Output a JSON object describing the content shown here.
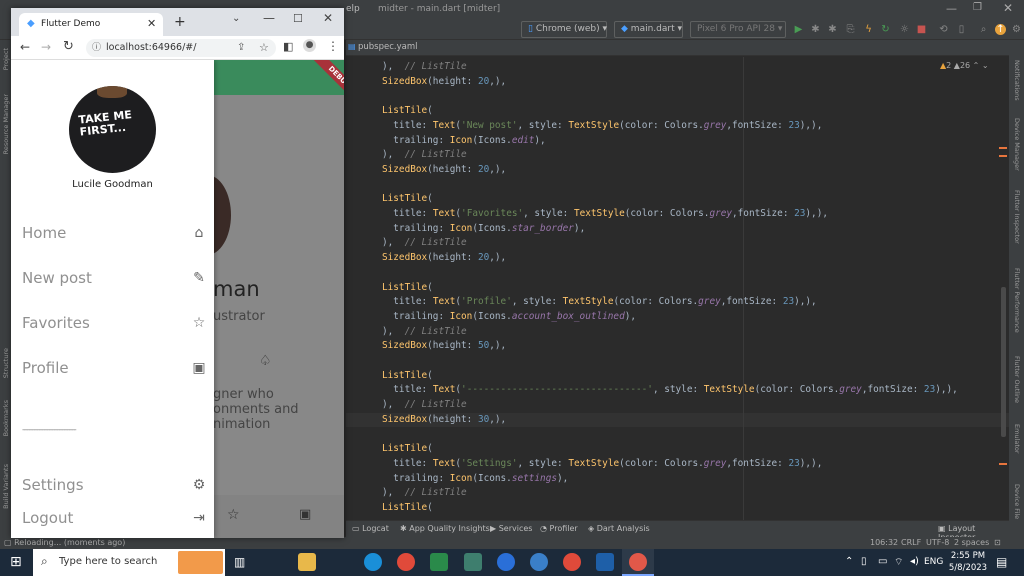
{
  "ide": {
    "menu_fragment": "elp",
    "title": "midter - main.dart [midter]",
    "device_combo": "Chrome (web)",
    "config_combo": "main.dart",
    "emulator_combo": "Pixel 6 Pro API 28",
    "file_tab": "pubspec.yaml",
    "inspection_warnings": "2",
    "inspection_weak": "26",
    "left_tools": [
      "Project",
      "Resource Manager",
      "Structure",
      "Bookmarks",
      "Build Variants"
    ],
    "right_tools": [
      "Notifications",
      "Device Manager",
      "Flutter Inspector",
      "Flutter Performance",
      "Flutter Outline",
      "Emulator",
      "Device File"
    ],
    "bottom_tools": [
      "Logcat",
      "App Quality Insights",
      "Services",
      "Profiler",
      "Dart Analysis"
    ],
    "layout_inspector": "Layout Inspector",
    "status_message": "Reloading... (moments ago)",
    "cursor_pos": "106:32",
    "line_sep": "CRLF",
    "encoding": "UTF-8",
    "indent": "2 spaces"
  },
  "code": [
    {
      "segs": [
        [
          "w",
          "),  "
        ],
        [
          "c",
          "// ListTile"
        ]
      ]
    },
    {
      "segs": [
        [
          "k",
          "SizedBox"
        ],
        [
          "w",
          "(height: "
        ],
        [
          "n",
          "20"
        ],
        [
          "w",
          ",),"
        ]
      ]
    },
    {
      "segs": [
        [
          "w",
          ""
        ]
      ]
    },
    {
      "segs": [
        [
          "k",
          "ListTile"
        ],
        [
          "w",
          "("
        ]
      ]
    },
    {
      "segs": [
        [
          "w",
          "  title: "
        ],
        [
          "k",
          "Text"
        ],
        [
          "w",
          "("
        ],
        [
          "s",
          "'New post'"
        ],
        [
          "w",
          ", style: "
        ],
        [
          "k",
          "TextStyle"
        ],
        [
          "w",
          "(color: Colors."
        ],
        [
          "p",
          "grey"
        ],
        [
          "w",
          ",fontSize: "
        ],
        [
          "n",
          "23"
        ],
        [
          "w",
          "),),"
        ]
      ]
    },
    {
      "segs": [
        [
          "w",
          "  trailing: "
        ],
        [
          "k",
          "Icon"
        ],
        [
          "w",
          "(Icons."
        ],
        [
          "p",
          "edit"
        ],
        [
          "w",
          "),"
        ]
      ]
    },
    {
      "segs": [
        [
          "w",
          "),  "
        ],
        [
          "c",
          "// ListTile"
        ]
      ]
    },
    {
      "segs": [
        [
          "k",
          "SizedBox"
        ],
        [
          "w",
          "(height: "
        ],
        [
          "n",
          "20"
        ],
        [
          "w",
          ",),"
        ]
      ]
    },
    {
      "segs": [
        [
          "w",
          ""
        ]
      ]
    },
    {
      "segs": [
        [
          "k",
          "ListTile"
        ],
        [
          "w",
          "("
        ]
      ]
    },
    {
      "segs": [
        [
          "w",
          "  title: "
        ],
        [
          "k",
          "Text"
        ],
        [
          "w",
          "("
        ],
        [
          "s",
          "'Favorites'"
        ],
        [
          "w",
          ", style: "
        ],
        [
          "k",
          "TextStyle"
        ],
        [
          "w",
          "(color: Colors."
        ],
        [
          "p",
          "grey"
        ],
        [
          "w",
          ",fontSize: "
        ],
        [
          "n",
          "23"
        ],
        [
          "w",
          "),),"
        ]
      ]
    },
    {
      "segs": [
        [
          "w",
          "  trailing: "
        ],
        [
          "k",
          "Icon"
        ],
        [
          "w",
          "(Icons."
        ],
        [
          "p",
          "star_border"
        ],
        [
          "w",
          "),"
        ]
      ]
    },
    {
      "segs": [
        [
          "w",
          "),  "
        ],
        [
          "c",
          "// ListTile"
        ]
      ]
    },
    {
      "segs": [
        [
          "k",
          "SizedBox"
        ],
        [
          "w",
          "(height: "
        ],
        [
          "n",
          "20"
        ],
        [
          "w",
          ",),"
        ]
      ]
    },
    {
      "segs": [
        [
          "w",
          ""
        ]
      ]
    },
    {
      "segs": [
        [
          "k",
          "ListTile"
        ],
        [
          "w",
          "("
        ]
      ]
    },
    {
      "segs": [
        [
          "w",
          "  title: "
        ],
        [
          "k",
          "Text"
        ],
        [
          "w",
          "("
        ],
        [
          "s",
          "'Profile'"
        ],
        [
          "w",
          ", style: "
        ],
        [
          "k",
          "TextStyle"
        ],
        [
          "w",
          "(color: Colors."
        ],
        [
          "p",
          "grey"
        ],
        [
          "w",
          ",fontSize: "
        ],
        [
          "n",
          "23"
        ],
        [
          "w",
          "),),"
        ]
      ]
    },
    {
      "segs": [
        [
          "w",
          "  trailing: "
        ],
        [
          "k",
          "Icon"
        ],
        [
          "w",
          "(Icons."
        ],
        [
          "p",
          "account_box_outlined"
        ],
        [
          "w",
          "),"
        ]
      ]
    },
    {
      "segs": [
        [
          "w",
          "),  "
        ],
        [
          "c",
          "// ListTile"
        ]
      ]
    },
    {
      "segs": [
        [
          "k",
          "SizedBox"
        ],
        [
          "w",
          "(height: "
        ],
        [
          "n",
          "50"
        ],
        [
          "w",
          ",),"
        ]
      ]
    },
    {
      "segs": [
        [
          "w",
          ""
        ]
      ]
    },
    {
      "segs": [
        [
          "k",
          "ListTile"
        ],
        [
          "w",
          "("
        ]
      ]
    },
    {
      "segs": [
        [
          "w",
          "  title: "
        ],
        [
          "k",
          "Text"
        ],
        [
          "w",
          "("
        ],
        [
          "s",
          "'--------------------------------'"
        ],
        [
          "w",
          ", style: "
        ],
        [
          "k",
          "TextStyle"
        ],
        [
          "w",
          "(color: Colors."
        ],
        [
          "p",
          "grey"
        ],
        [
          "w",
          ",fontSize: "
        ],
        [
          "n",
          "23"
        ],
        [
          "w",
          "),),"
        ]
      ]
    },
    {
      "segs": [
        [
          "w",
          "),  "
        ],
        [
          "c",
          "// ListTile"
        ]
      ]
    },
    {
      "segs": [
        [
          "k",
          "SizedBox"
        ],
        [
          "w",
          "(height: "
        ],
        [
          "n",
          "30"
        ],
        [
          "w",
          ",),"
        ]
      ]
    },
    {
      "segs": [
        [
          "w",
          ""
        ]
      ]
    },
    {
      "segs": [
        [
          "k",
          "ListTile"
        ],
        [
          "w",
          "("
        ]
      ]
    },
    {
      "segs": [
        [
          "w",
          "  title: "
        ],
        [
          "k",
          "Text"
        ],
        [
          "w",
          "("
        ],
        [
          "s",
          "'Settings'"
        ],
        [
          "w",
          ", style: "
        ],
        [
          "k",
          "TextStyle"
        ],
        [
          "w",
          "(color: Colors."
        ],
        [
          "p",
          "grey"
        ],
        [
          "w",
          ",fontSize: "
        ],
        [
          "n",
          "23"
        ],
        [
          "w",
          "),),"
        ]
      ]
    },
    {
      "segs": [
        [
          "w",
          "  trailing: "
        ],
        [
          "k",
          "Icon"
        ],
        [
          "w",
          "(Icons."
        ],
        [
          "p",
          "settings"
        ],
        [
          "w",
          "),"
        ]
      ]
    },
    {
      "segs": [
        [
          "w",
          "),  "
        ],
        [
          "c",
          "// ListTile"
        ]
      ]
    },
    {
      "segs": [
        [
          "k",
          "ListTile"
        ],
        [
          "w",
          "("
        ]
      ]
    }
  ],
  "chrome": {
    "tab_title": "Flutter Demo",
    "url": "localhost:64966/#/"
  },
  "app": {
    "debug_banner": "DEBUG",
    "avatar_text": "TAKE ME FIRST...",
    "user_name": "Lucile Goodman",
    "drawer_items": [
      {
        "label": "Home",
        "icon": "home-icon",
        "glyph": "⌂"
      },
      {
        "label": "New post",
        "icon": "edit-icon",
        "glyph": "✎"
      },
      {
        "label": "Favorites",
        "icon": "star-border-icon",
        "glyph": "☆"
      },
      {
        "label": "Profile",
        "icon": "account-box-icon",
        "glyph": "▣"
      }
    ],
    "divider_text": "--------------------------------",
    "settings_label": "Settings",
    "logout_label": "Logout",
    "bg_name_fragment": "man",
    "bg_role_fragment": "ustrator",
    "bg_desc": [
      "gner who",
      "onments and",
      "nimation"
    ]
  },
  "taskbar": {
    "search_placeholder": "Type here to search",
    "time": "2:55 PM",
    "date": "5/8/2023",
    "lang": "ENG"
  }
}
